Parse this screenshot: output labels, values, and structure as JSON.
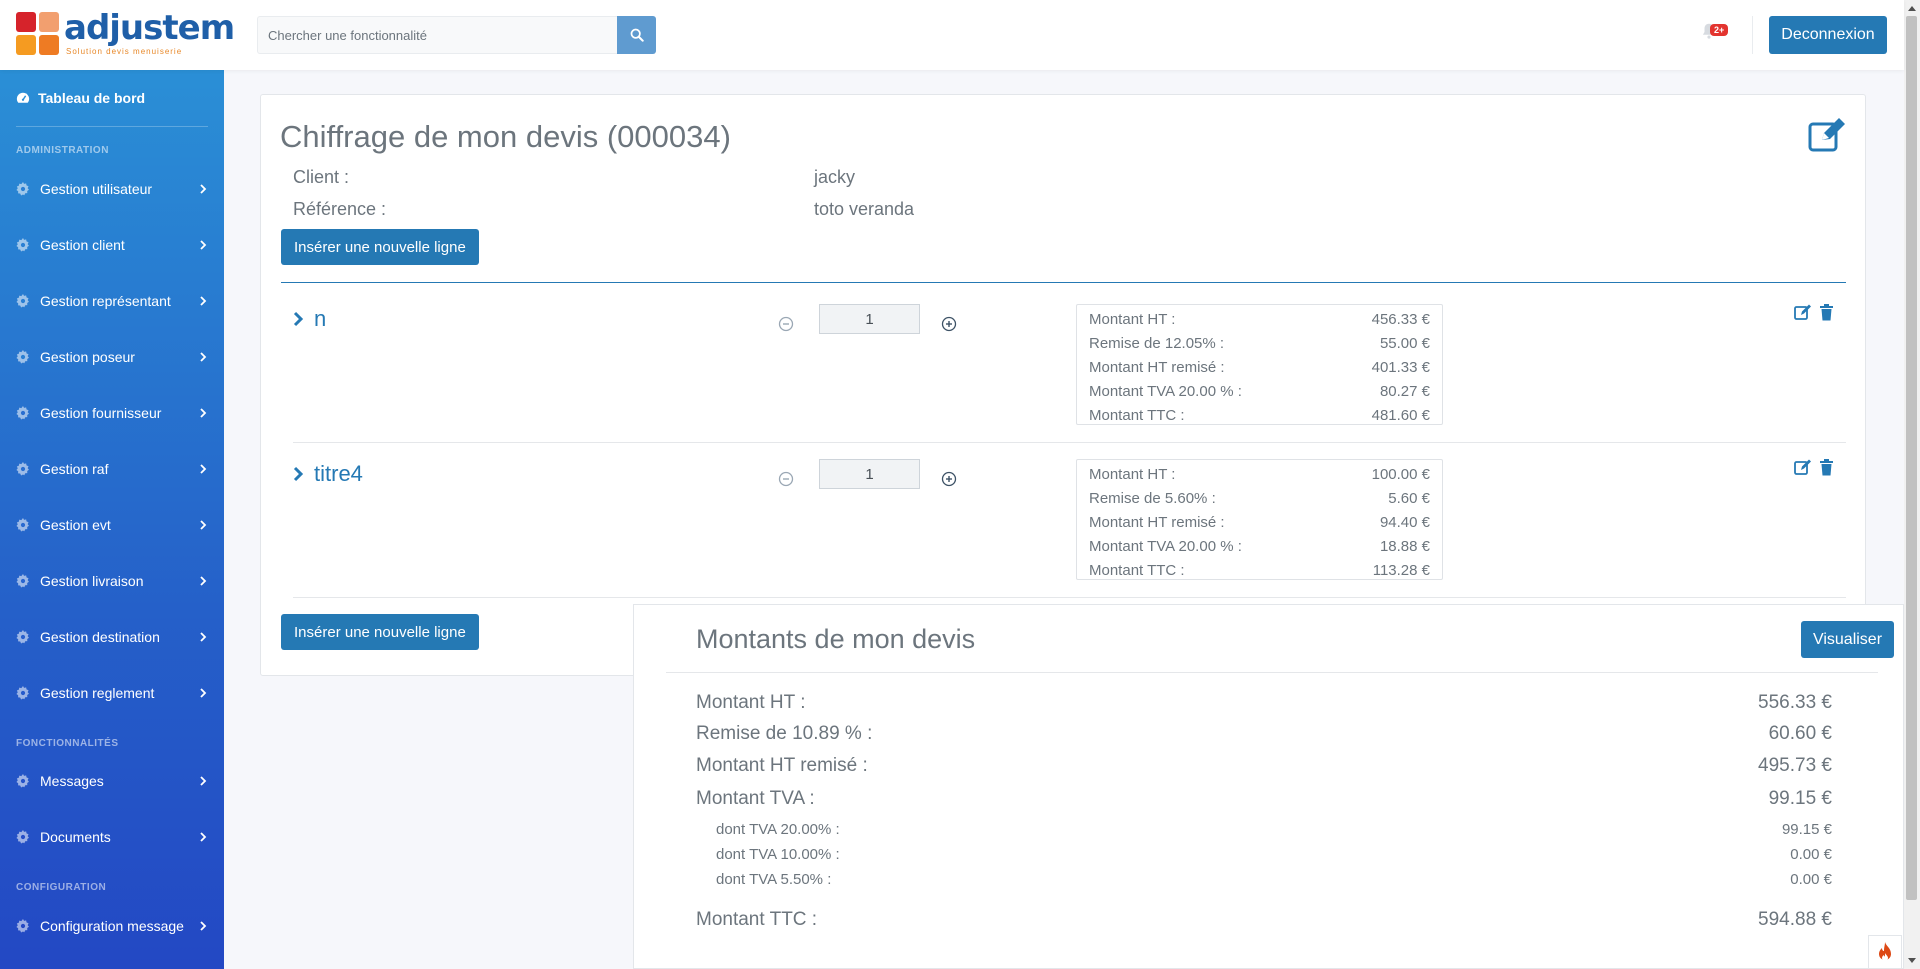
{
  "header": {
    "logo_text": "adjustem",
    "logo_tagline": "Solution devis menuiserie",
    "search_placeholder": "Chercher une fonctionnalité",
    "notification_badge": "2+",
    "logout_label": "Deconnexion"
  },
  "sidebar": {
    "home_label": "Tableau de bord",
    "sections": [
      {
        "heading": "ADMINISTRATION"
      },
      {
        "heading": "FONCTIONNALITÉS"
      },
      {
        "heading": "CONFIGURATION"
      }
    ],
    "items": [
      {
        "label": "Gestion utilisateur"
      },
      {
        "label": "Gestion client"
      },
      {
        "label": "Gestion représentant"
      },
      {
        "label": "Gestion poseur"
      },
      {
        "label": "Gestion fournisseur"
      },
      {
        "label": "Gestion raf"
      },
      {
        "label": "Gestion evt"
      },
      {
        "label": "Gestion livraison"
      },
      {
        "label": "Gestion destination"
      },
      {
        "label": "Gestion reglement"
      },
      {
        "label": "Messages"
      },
      {
        "label": "Documents"
      },
      {
        "label": "Configuration message"
      }
    ]
  },
  "quote": {
    "title": "Chiffrage de mon devis (000034)",
    "client_label": "Client :",
    "client_value": "jacky",
    "reference_label": "Référence :",
    "reference_value": "toto veranda",
    "insert_line_label": "Insérer une nouvelle ligne",
    "lines": [
      {
        "title": "n",
        "quantity": "1",
        "amounts": [
          {
            "label": "Montant HT :",
            "value": "456.33 €"
          },
          {
            "label": "Remise de 12.05% :",
            "value": "55.00 €"
          },
          {
            "label": "Montant HT remisé :",
            "value": "401.33 €"
          },
          {
            "label": "Montant TVA 20.00 % :",
            "value": "80.27 €"
          },
          {
            "label": "Montant TTC :",
            "value": "481.60 €"
          }
        ]
      },
      {
        "title": "titre4",
        "quantity": "1",
        "amounts": [
          {
            "label": "Montant HT :",
            "value": "100.00 €"
          },
          {
            "label": "Remise de 5.60% :",
            "value": "5.60 €"
          },
          {
            "label": "Montant HT remisé :",
            "value": "94.40 €"
          },
          {
            "label": "Montant TVA 20.00 % :",
            "value": "18.88 €"
          },
          {
            "label": "Montant TTC :",
            "value": "113.28 €"
          }
        ]
      }
    ]
  },
  "summary": {
    "title": "Montants de mon devis",
    "visualise_label": "Visualiser",
    "rows": [
      {
        "label": "Montant HT :",
        "value": "556.33 €"
      },
      {
        "label": "Remise de 10.89 % :",
        "value": "60.60 €"
      },
      {
        "label": "Montant HT remisé :",
        "value": "495.73 €"
      },
      {
        "label": "Montant TVA :",
        "value": "99.15 €"
      }
    ],
    "tva_rows": [
      {
        "label": "dont TVA 20.00% :",
        "value": "99.15 €"
      },
      {
        "label": "dont TVA 10.00% :",
        "value": "0.00 €"
      },
      {
        "label": "dont TVA 5.50% :",
        "value": "0.00 €"
      }
    ],
    "ttc_label": "Montant TTC :",
    "ttc_value": "594.88 €"
  },
  "colors": {
    "primary": "#2579b4",
    "sidebar_top": "#2a8fd6",
    "sidebar_bottom": "#2348c4",
    "badge": "#e3342f"
  },
  "icons": {
    "search": "search-icon",
    "bell": "bell-icon",
    "dashboard": "dashboard-icon",
    "gear": "gear-icon",
    "chevron": "chevron-right-icon",
    "edit": "edit-icon",
    "trash": "trash-icon",
    "minus": "minus-circle-icon",
    "plus": "plus-circle-icon",
    "fire": "fire-icon"
  }
}
